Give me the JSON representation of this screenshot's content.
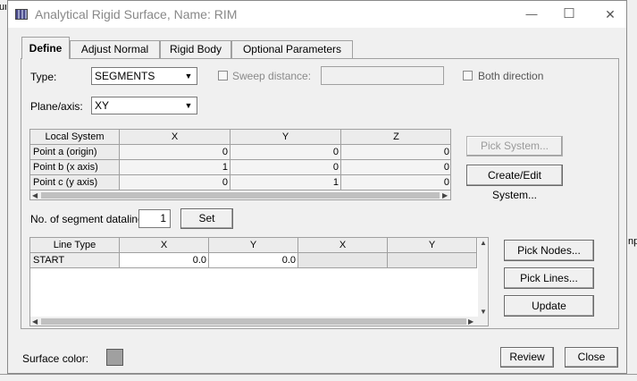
{
  "window": {
    "title": "Analytical Rigid Surface,  Name: RIM",
    "minimize": "—",
    "maximize": "☐",
    "close": "✕"
  },
  "background": {
    "left_text": "urfac",
    "right_text": "np"
  },
  "tabs": [
    "Define",
    "Adjust Normal",
    "Rigid Body",
    "Optional Parameters"
  ],
  "type": {
    "label": "Type:",
    "value": "SEGMENTS"
  },
  "sweep": {
    "label": "Sweep distance:",
    "checked": false,
    "value": ""
  },
  "both_direction": {
    "label": "Both direction",
    "checked": false
  },
  "plane": {
    "label": "Plane/axis:",
    "value": "XY"
  },
  "local_system": {
    "headers": [
      "Local System",
      "X",
      "Y",
      "Z"
    ],
    "rows": [
      {
        "name": "Point a (origin)",
        "x": "0",
        "y": "0",
        "z": "0"
      },
      {
        "name": "Point b (x axis)",
        "x": "1",
        "y": "0",
        "z": "0"
      },
      {
        "name": "Point c (y axis)",
        "x": "0",
        "y": "1",
        "z": "0"
      }
    ]
  },
  "buttons": {
    "pick_system": "Pick System...",
    "create_edit_system": "Create/Edit System...",
    "set": "Set",
    "pick_nodes": "Pick Nodes...",
    "pick_lines": "Pick Lines...",
    "update": "Update",
    "review": "Review",
    "close": "Close"
  },
  "segments": {
    "label": "No. of segment datalines:",
    "value": "1"
  },
  "line_table": {
    "headers": [
      "Line Type",
      "X",
      "Y",
      "X",
      "Y"
    ],
    "rows": [
      {
        "type": "START",
        "x1": "0.0",
        "y1": "0.0",
        "x2": "",
        "y2": ""
      }
    ]
  },
  "surface_color": {
    "label": "Surface color:",
    "color": "#a0a0a0"
  },
  "icons": {
    "dropdown": "chevron-down-icon",
    "scroll_left": "arrow-left-icon",
    "scroll_right": "arrow-right-icon"
  }
}
